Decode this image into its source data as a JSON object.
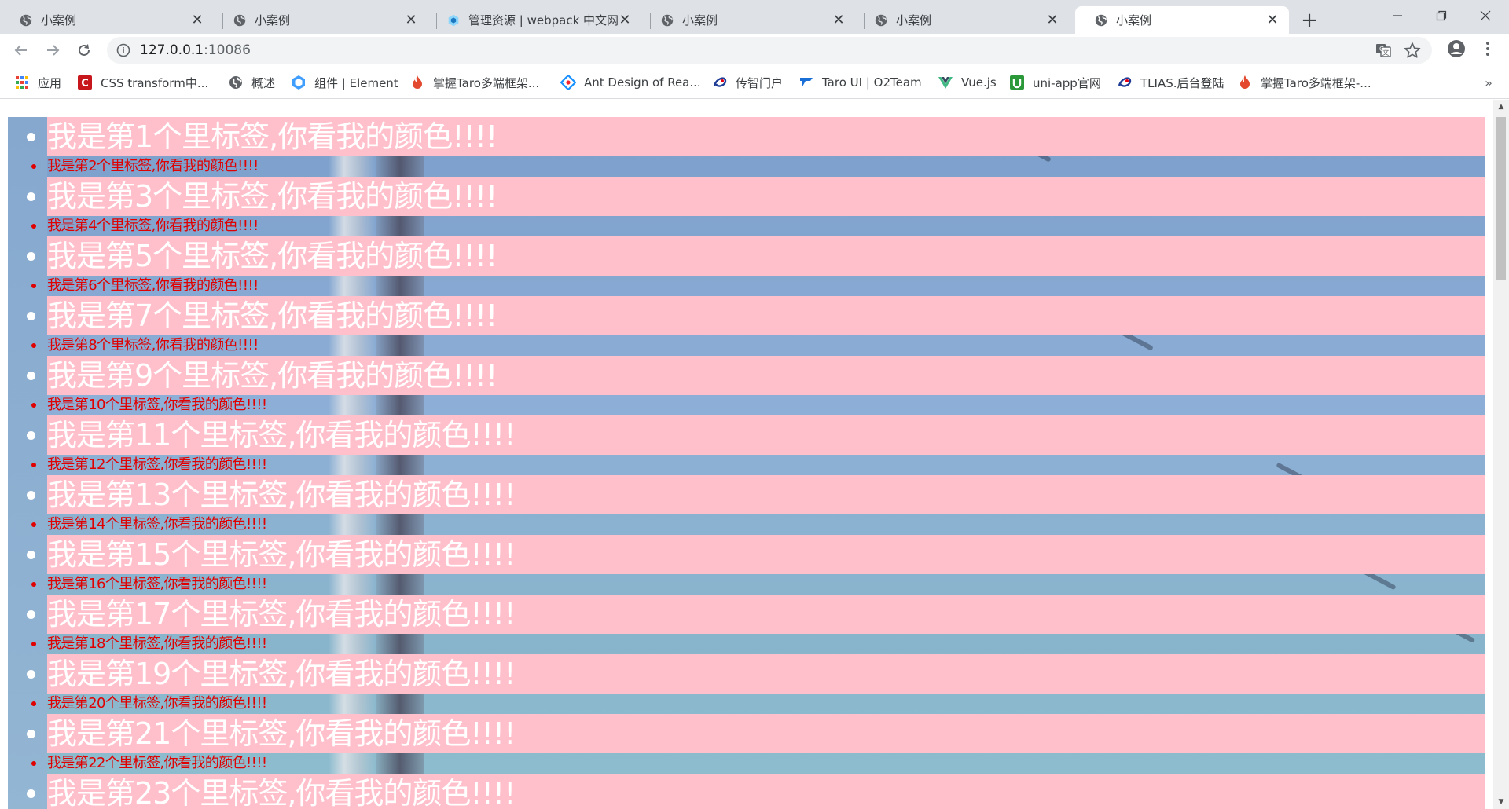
{
  "browser": {
    "tabs": [
      {
        "title": "小案例",
        "icon": "globe-icon",
        "active": false
      },
      {
        "title": "小案例",
        "icon": "globe-icon",
        "active": false
      },
      {
        "title": "管理资源 | webpack 中文网",
        "icon": "webpack-icon",
        "active": false
      },
      {
        "title": "小案例",
        "icon": "globe-icon",
        "active": false
      },
      {
        "title": "小案例",
        "icon": "globe-icon",
        "active": false
      },
      {
        "title": "小案例",
        "icon": "globe-icon",
        "active": true
      }
    ],
    "new_tab_label": "+",
    "url_host": "127.0.0.1",
    "url_port": ":10086"
  },
  "bookmarks": [
    {
      "label": "应用",
      "icon": "apps-grid-icon",
      "color": "#e94235"
    },
    {
      "label": "CSS transform中...",
      "icon": "csdn-icon",
      "color": "#c8161d"
    },
    {
      "label": "概述",
      "icon": "globe-icon",
      "color": "#5f6368"
    },
    {
      "label": "组件 | Element",
      "icon": "element-icon",
      "color": "#409eff"
    },
    {
      "label": "掌握Taro多端框架...",
      "icon": "flame-icon",
      "color": "#e2492f"
    },
    {
      "label": "Ant Design of Rea...",
      "icon": "antd-icon",
      "color": "#1890ff"
    },
    {
      "label": "传智门户",
      "icon": "itcast-icon",
      "color": "#1e3c96"
    },
    {
      "label": "Taro UI | O2Team",
      "icon": "taro-icon",
      "color": "#1a6fd6"
    },
    {
      "label": "Vue.js",
      "icon": "vue-icon",
      "color": "#41b883"
    },
    {
      "label": "uni-app官网",
      "icon": "uniapp-icon",
      "color": "#2b9939"
    },
    {
      "label": "TLIAS.后台登陆",
      "icon": "itcast-icon",
      "color": "#1e3c96"
    },
    {
      "label": "掌握Taro多端框架-...",
      "icon": "flame-icon",
      "color": "#e2492f"
    }
  ],
  "page": {
    "items": [
      "我是第1个里标签,你看我的颜色!!!!",
      "我是第2个里标签,你看我的颜色!!!!",
      "我是第3个里标签,你看我的颜色!!!!",
      "我是第4个里标签,你看我的颜色!!!!",
      "我是第5个里标签,你看我的颜色!!!!",
      "我是第6个里标签,你看我的颜色!!!!",
      "我是第7个里标签,你看我的颜色!!!!",
      "我是第8个里标签,你看我的颜色!!!!",
      "我是第9个里标签,你看我的颜色!!!!",
      "我是第10个里标签,你看我的颜色!!!!",
      "我是第11个里标签,你看我的颜色!!!!",
      "我是第12个里标签,你看我的颜色!!!!",
      "我是第13个里标签,你看我的颜色!!!!",
      "我是第14个里标签,你看我的颜色!!!!",
      "我是第15个里标签,你看我的颜色!!!!",
      "我是第16个里标签,你看我的颜色!!!!",
      "我是第17个里标签,你看我的颜色!!!!",
      "我是第18个里标签,你看我的颜色!!!!",
      "我是第19个里标签,你看我的颜色!!!!",
      "我是第20个里标签,你看我的颜色!!!!",
      "我是第21个里标签,你看我的颜色!!!!",
      "我是第22个里标签,你看我的颜色!!!!",
      "我是第23个里标签,你看我的颜色!!!!"
    ],
    "odd_item_background": "#ffc0cb",
    "odd_item_color": "#ffffff",
    "even_item_color": "#e00000"
  }
}
